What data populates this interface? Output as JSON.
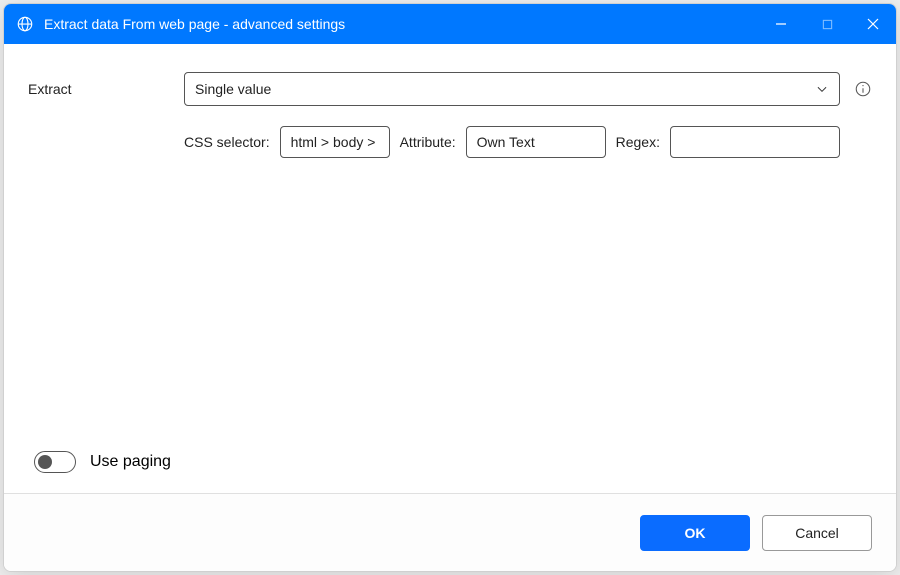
{
  "titlebar": {
    "title": "Extract data From web page - advanced settings"
  },
  "form": {
    "extract_label": "Extract",
    "extract_dropdown": {
      "selected": "Single value"
    },
    "css_selector_label": "CSS selector:",
    "css_selector_value": "html > body >",
    "attribute_label": "Attribute:",
    "attribute_value": "Own Text",
    "regex_label": "Regex:",
    "regex_value": ""
  },
  "paging": {
    "label": "Use paging",
    "enabled": false
  },
  "footer": {
    "ok_label": "OK",
    "cancel_label": "Cancel"
  }
}
